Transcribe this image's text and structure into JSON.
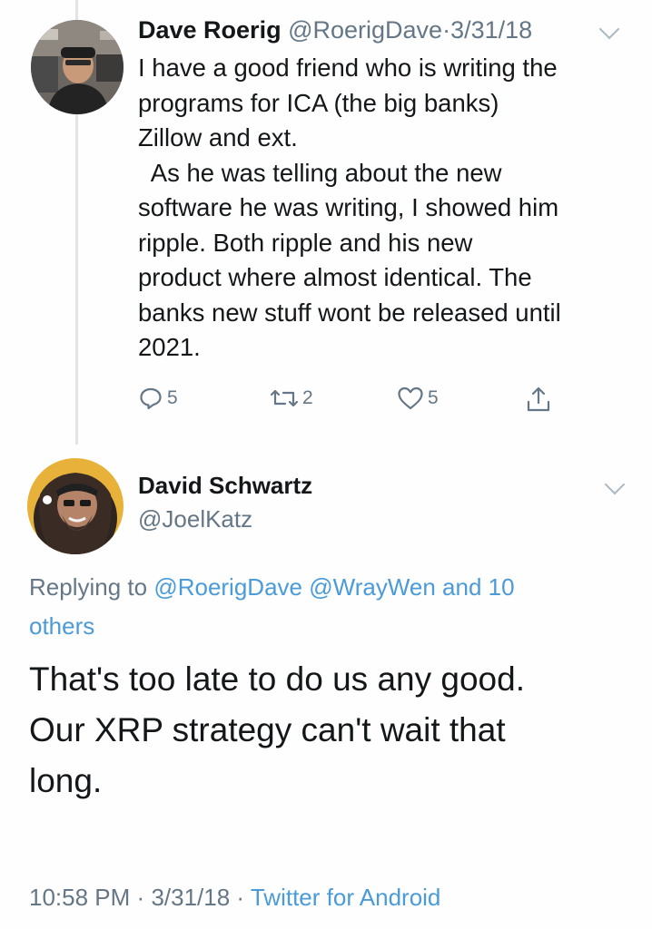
{
  "tweet1": {
    "name": "Dave Roerig",
    "handle": "@RoerigDave",
    "separator": "·",
    "date": "3/31/18",
    "body_lines": [
      "I have a good friend who is writing the",
      "programs for ICA (the big banks)",
      "Zillow and ext.",
      "  As he was telling about the new",
      "software he was writing, I showed him",
      "ripple. Both ripple and his new",
      "product where almost identical. The",
      "banks new stuff wont be released until",
      "2021."
    ],
    "replies": "5",
    "retweets": "2",
    "likes": "5"
  },
  "tweet2": {
    "name": "David Schwartz",
    "handle": "@JoelKatz",
    "replying_prefix": "Replying to",
    "mention1": "@RoerigDave",
    "mention2": "@WrayWen",
    "mention_rest": "and 10",
    "mention_rest2": "others",
    "body_lines": [
      "That's too late to do us any good.",
      "Our XRP strategy can't wait that",
      "long."
    ],
    "time": "10:58 PM",
    "separator": "·",
    "date": "3/31/18",
    "separator2": "·",
    "source": "Twitter for Android"
  },
  "colors": {
    "text": "#14171a",
    "muted": "#657786",
    "link": "#4a9bd8",
    "thread_line": "#e1e5e8"
  },
  "icons": [
    "reply-icon",
    "retweet-icon",
    "like-icon",
    "share-icon",
    "chevron-down-icon"
  ]
}
